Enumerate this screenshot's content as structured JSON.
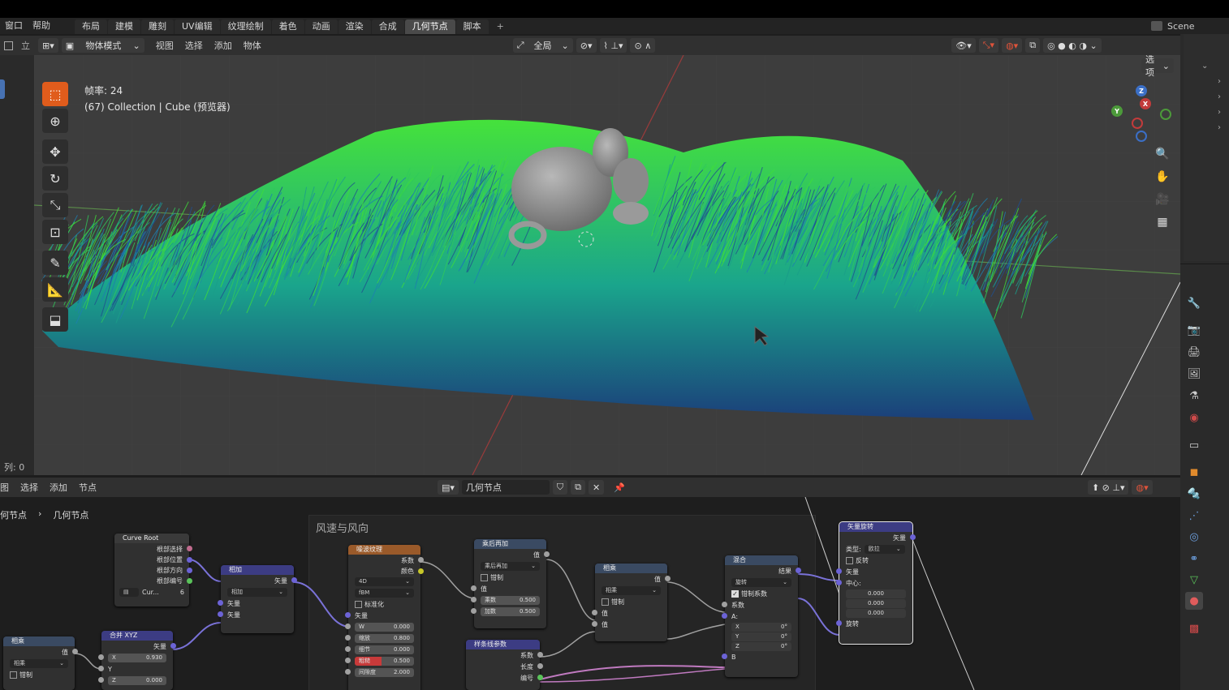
{
  "menubar": {
    "menus": [
      "窗口",
      "帮助"
    ],
    "workspaces": [
      "布局",
      "建模",
      "雕刻",
      "UV编辑",
      "纹理绘制",
      "着色",
      "动画",
      "渲染",
      "合成",
      "几何节点",
      "脚本"
    ],
    "active_workspace": "几何节点",
    "add_tab": "+",
    "scene_label": "Scene"
  },
  "viewport_header": {
    "view_label": "立",
    "mode": "物体模式",
    "menus": [
      "视图",
      "选择",
      "添加",
      "物体"
    ],
    "transform_orientation": "全局",
    "options_label": "选项"
  },
  "viewport": {
    "frame_rate": "帧率: 24",
    "collection_info": "(67) Collection | Cube (预览器)",
    "column_readout": "列: 0"
  },
  "node_header": {
    "menus": [
      "图",
      "选择",
      "添加",
      "节点"
    ],
    "tree_name": "几何节点"
  },
  "breadcrumb": {
    "parent": "何节点",
    "current": "几何节点"
  },
  "frame_label": "风速与风向",
  "nodes": {
    "curve_root": {
      "title": "Curve Root",
      "outputs": [
        "根部选择",
        "根部位置",
        "根部方向",
        "根部编号"
      ],
      "field": "Cur...",
      "count": "6"
    },
    "add": {
      "title": "相加",
      "output": "矢量",
      "mode": "相加",
      "inputs": [
        "矢量",
        "矢量"
      ]
    },
    "noise": {
      "title": "噪波纹理",
      "outputs": [
        "系数",
        "颜色"
      ],
      "dim": "4D",
      "type": "fBM",
      "normalize": "标准化",
      "vector": "矢量",
      "fields": [
        {
          "label": "W",
          "value": "0.000"
        },
        {
          "label": "缩放",
          "value": "0.800"
        },
        {
          "label": "细节",
          "value": "0.000"
        },
        {
          "label": "粗糙",
          "value": "0.500"
        },
        {
          "label": "间隙度",
          "value": "2.000"
        }
      ]
    },
    "multiply_add": {
      "title": "乘后再加",
      "output": "值",
      "mode": "乘后再加",
      "clamp": "钳制",
      "input": "值",
      "fields": [
        {
          "label": "乘数",
          "value": "0.500"
        },
        {
          "label": "加数",
          "value": "0.500"
        }
      ]
    },
    "multiply": {
      "title": "相乘",
      "output": "值",
      "mode": "相乘",
      "clamp": "钳制",
      "inputs": [
        "值",
        "值"
      ]
    },
    "spline_param": {
      "title": "样条线参数",
      "outputs": [
        "系数",
        "长度",
        "编号"
      ]
    },
    "mix": {
      "title": "混合",
      "output": "结果",
      "mode": "旋转",
      "clamp": "钳制系数",
      "inputs": [
        "系数",
        "A:"
      ],
      "xyz": [
        {
          "label": "X",
          "value": "0°"
        },
        {
          "label": "Y",
          "value": "0°"
        },
        {
          "label": "Z",
          "value": "0°"
        }
      ],
      "b": "B"
    },
    "vector_rotate": {
      "title": "矢量旋转",
      "output": "矢量",
      "type_label": "类型:",
      "type_value": "欧拉",
      "invert": "反转",
      "vector": "矢量",
      "center": "中心:",
      "center_values": [
        "0.000",
        "0.000",
        "0.000"
      ],
      "rotation": "旋转"
    },
    "combine_xyz": {
      "title": "合并 XYZ",
      "output": "矢量",
      "fields": [
        {
          "label": "X",
          "value": "0.930"
        },
        {
          "label": "Y",
          "value": ""
        },
        {
          "label": "Z",
          "value": "0.000"
        }
      ]
    },
    "multiply2": {
      "title": "相乘",
      "output": "值",
      "mode": "相乘",
      "clamp": "钳制"
    }
  },
  "colors": {
    "active_tool": "#e05c1c",
    "grass_green": "#3fdd3a",
    "grass_teal": "#1a9e8a",
    "grass_blue": "#1f4f8f"
  },
  "icons": [
    "select-box-icon",
    "cursor-icon",
    "move-icon",
    "rotate-icon",
    "scale-icon",
    "transform-icon",
    "annotate-icon",
    "measure-icon",
    "add-cube-icon",
    "zoom-icon",
    "hand-icon",
    "camera-icon",
    "grid-icon"
  ]
}
